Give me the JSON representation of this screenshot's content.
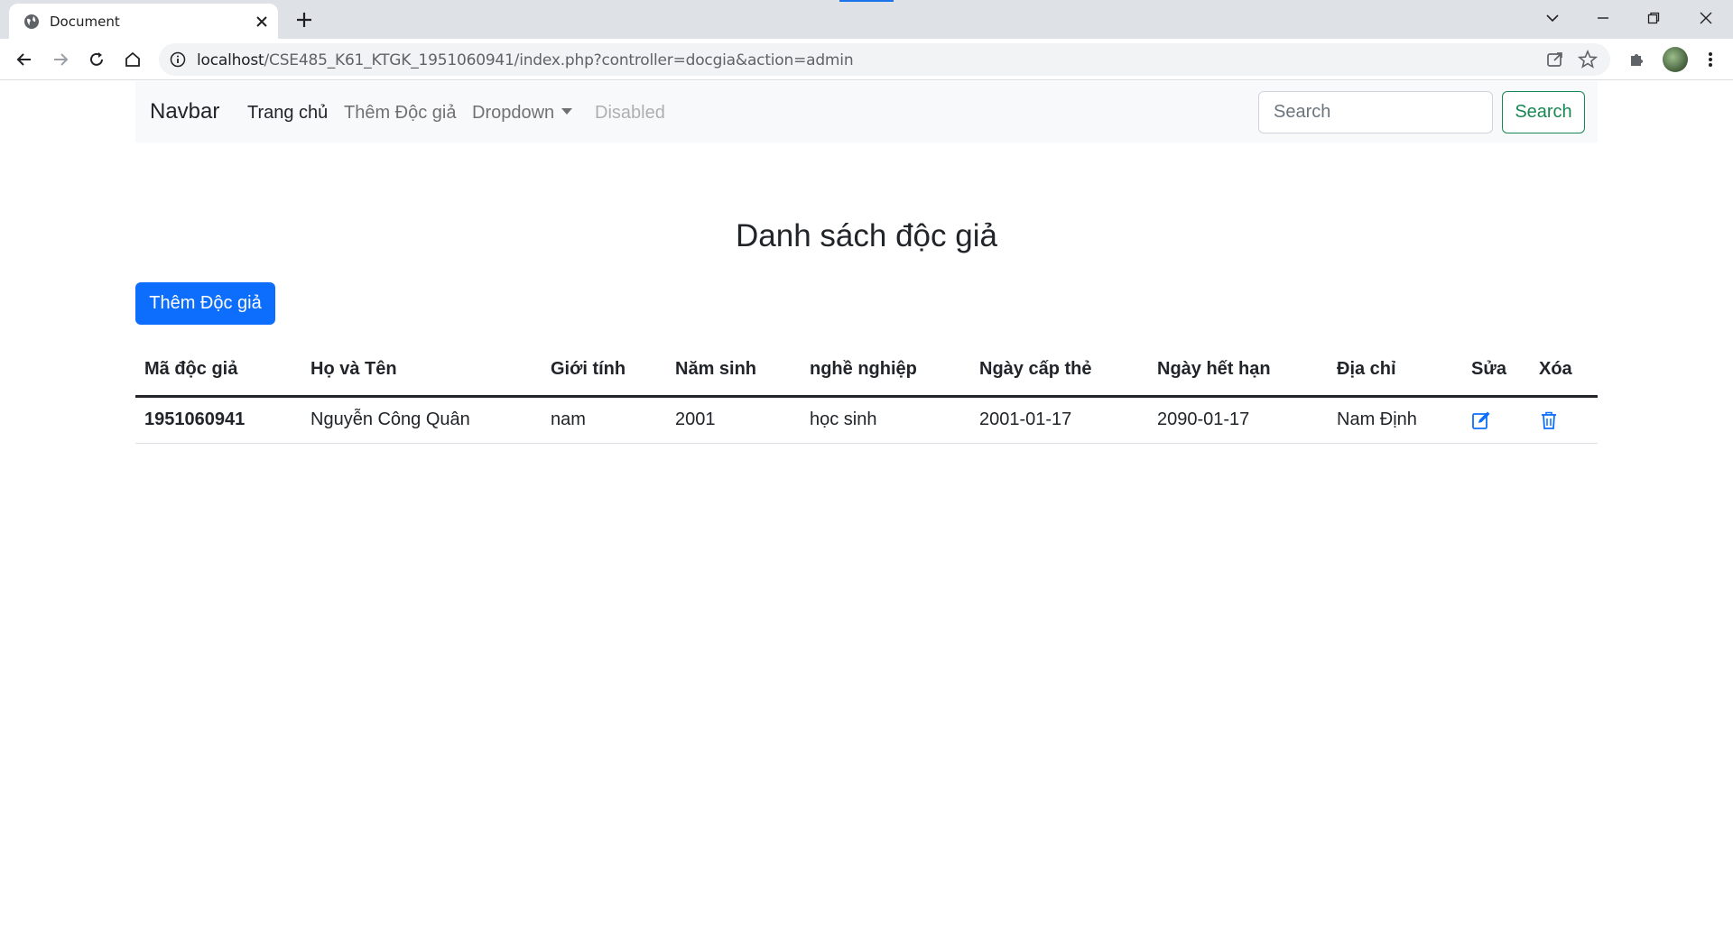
{
  "browser": {
    "tab_title": "Document",
    "url_host": "localhost",
    "url_path": "/CSE485_K61_KTGK_1951060941/index.php?controller=docgia&action=admin"
  },
  "navbar": {
    "brand": "Navbar",
    "links": [
      {
        "label": "Trang chủ",
        "state": "active"
      },
      {
        "label": "Thêm Độc giả",
        "state": "normal"
      },
      {
        "label": "Dropdown",
        "state": "dropdown"
      },
      {
        "label": "Disabled",
        "state": "disabled"
      }
    ],
    "search_placeholder": "Search",
    "search_button": "Search"
  },
  "main": {
    "title": "Danh sách độc giả",
    "add_button": "Thêm Độc giả",
    "table": {
      "headers": [
        "Mã độc giả",
        "Họ và Tên",
        "Giới tính",
        "Năm sinh",
        "nghề nghiệp",
        "Ngày cấp thẻ",
        "Ngày hết hạn",
        "Địa chỉ",
        "Sửa",
        "Xóa"
      ],
      "rows": [
        {
          "id": "1951060941",
          "name": "Nguyễn Công Quân",
          "gender": "nam",
          "birth_year": "2001",
          "job": "học sinh",
          "issue_date": "2001-01-17",
          "expiry_date": "2090-01-17",
          "address": "Nam Định",
          "edit_icon": "edit-icon",
          "delete_icon": "trash-icon"
        }
      ]
    }
  },
  "colors": {
    "primary": "#0d6efd",
    "success": "#198754",
    "navbar_bg": "#f8f9fa"
  }
}
